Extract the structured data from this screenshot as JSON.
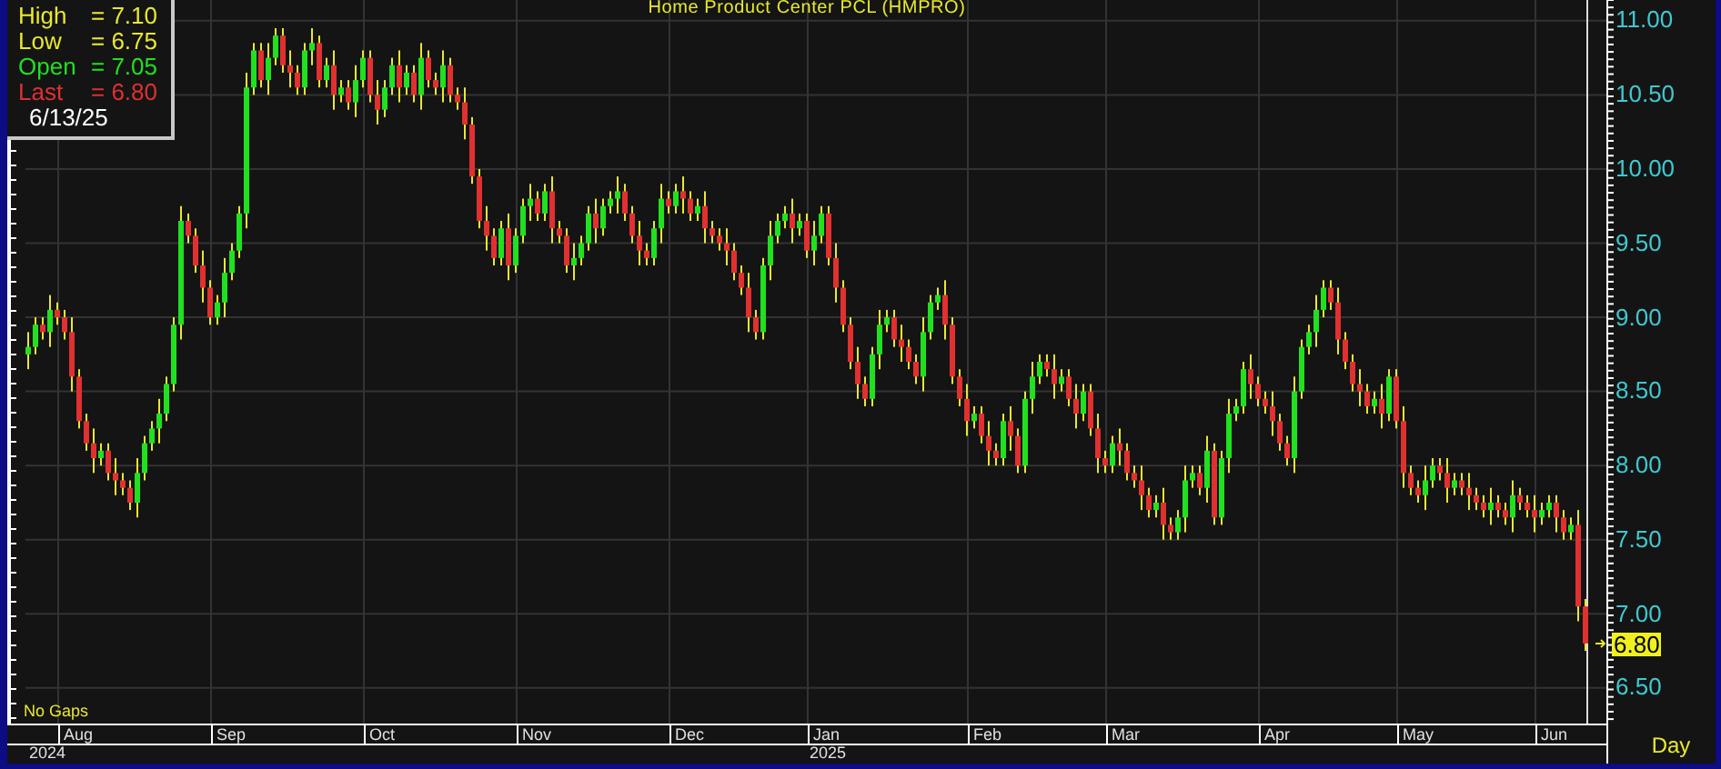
{
  "chart": {
    "legend": [
      {
        "label": "High",
        "value": "= 7.10",
        "color": "#e8e830"
      },
      {
        "label": "Low",
        "value": "= 6.75",
        "color": "#e8e830"
      },
      {
        "label": "Open",
        "value": "= 7.05",
        "color": "#20e020"
      },
      {
        "label": "Last",
        "value": "= 6.80",
        "color": "#e03030"
      }
    ],
    "date": "6/13/25",
    "gap_mode": "No Gaps",
    "period": "Day",
    "last_price": "6.80",
    "years": [
      "2024",
      "2025"
    ],
    "chart_data": {
      "type": "candlestick",
      "title": "Home Product Center PCL (HMPRO)",
      "ylim": [
        6.26,
        11.14
      ],
      "yticks": [
        {
          "value": 11,
          "label": "11.00"
        },
        {
          "value": 10.5,
          "label": "10.50"
        },
        {
          "value": 10,
          "label": "10.00"
        },
        {
          "value": 9.5,
          "label": "9.50"
        },
        {
          "value": 9,
          "label": "9.00"
        },
        {
          "value": 8.5,
          "label": "8.50"
        },
        {
          "value": 8,
          "label": "8.00"
        },
        {
          "value": 7.5,
          "label": "7.50"
        },
        {
          "value": 7,
          "label": "7.00"
        },
        {
          "value": 6.5,
          "label": "6.50"
        }
      ],
      "grid": true,
      "categories": [
        null,
        null,
        null,
        null,
        null,
        null,
        null,
        "Aug",
        null,
        null,
        null,
        null,
        null,
        null,
        null,
        null,
        null,
        null,
        null,
        null,
        null,
        null,
        null,
        null,
        null,
        null,
        null,
        null,
        "Sep",
        null,
        null,
        null,
        null,
        null,
        null,
        null,
        null,
        null,
        null,
        null,
        null,
        null,
        null,
        null,
        null,
        null,
        null,
        null,
        null,
        "Oct",
        null,
        null,
        null,
        null,
        null,
        null,
        null,
        null,
        null,
        null,
        null,
        null,
        null,
        null,
        null,
        null,
        null,
        null,
        null,
        null,
        "Nov",
        null,
        null,
        null,
        null,
        null,
        null,
        null,
        null,
        null,
        null,
        null,
        null,
        null,
        null,
        null,
        null,
        null,
        null,
        null,
        null,
        "Dec",
        null,
        null,
        null,
        null,
        null,
        null,
        null,
        null,
        null,
        null,
        null,
        null,
        null,
        null,
        null,
        null,
        null,
        null,
        "Jan",
        null,
        null,
        null,
        null,
        null,
        null,
        null,
        null,
        null,
        null,
        null,
        null,
        null,
        null,
        null,
        null,
        null,
        null,
        null,
        null,
        null,
        "Feb",
        null,
        null,
        null,
        null,
        null,
        null,
        null,
        null,
        null,
        null,
        null,
        null,
        null,
        null,
        null,
        null,
        null,
        null,
        "Mar",
        null,
        null,
        null,
        null,
        null,
        null,
        null,
        null,
        null,
        null,
        null,
        null,
        null,
        null,
        null,
        null,
        null,
        null,
        null,
        null,
        "Apr",
        null,
        null,
        null,
        null,
        null,
        null,
        null,
        null,
        null,
        null,
        null,
        null,
        null,
        null,
        null,
        null,
        null,
        null,
        "May",
        null,
        null,
        null,
        null,
        null,
        null,
        null,
        null,
        null,
        null,
        null,
        null,
        null,
        null,
        null,
        null,
        null,
        null,
        "Jun",
        null,
        null,
        null,
        null
      ],
      "ohlc": [
        [
          8.75,
          8.9,
          8.65,
          8.8
        ],
        [
          8.8,
          9.0,
          8.75,
          8.95
        ],
        [
          8.95,
          9.0,
          8.85,
          8.9
        ],
        [
          8.9,
          9.15,
          8.8,
          9.05
        ],
        [
          9.05,
          9.1,
          8.95,
          9.0
        ],
        [
          9.0,
          9.05,
          8.85,
          8.9
        ],
        [
          8.9,
          9.0,
          8.5,
          8.6
        ],
        [
          8.6,
          8.65,
          8.25,
          8.3
        ],
        [
          8.3,
          8.35,
          8.1,
          8.15
        ],
        [
          8.15,
          8.25,
          7.95,
          8.05
        ],
        [
          8.05,
          8.15,
          8.0,
          8.1
        ],
        [
          8.1,
          8.15,
          7.9,
          7.95
        ],
        [
          7.95,
          8.05,
          7.8,
          7.9
        ],
        [
          7.9,
          7.95,
          7.8,
          7.85
        ],
        [
          7.85,
          7.9,
          7.7,
          7.75
        ],
        [
          7.75,
          8.05,
          7.65,
          7.95
        ],
        [
          7.95,
          8.2,
          7.9,
          8.15
        ],
        [
          8.15,
          8.3,
          8.1,
          8.25
        ],
        [
          8.25,
          8.45,
          8.15,
          8.35
        ],
        [
          8.35,
          8.6,
          8.3,
          8.55
        ],
        [
          8.55,
          9.0,
          8.5,
          8.95
        ],
        [
          8.95,
          9.75,
          8.85,
          9.65
        ],
        [
          9.65,
          9.7,
          9.5,
          9.55
        ],
        [
          9.55,
          9.6,
          9.3,
          9.35
        ],
        [
          9.35,
          9.45,
          9.1,
          9.2
        ],
        [
          9.2,
          9.25,
          8.95,
          9.0
        ],
        [
          9.0,
          9.15,
          8.95,
          9.1
        ],
        [
          9.1,
          9.4,
          9.0,
          9.3
        ],
        [
          9.3,
          9.5,
          9.25,
          9.45
        ],
        [
          9.45,
          9.75,
          9.4,
          9.7
        ],
        [
          9.7,
          10.65,
          9.6,
          10.55
        ],
        [
          10.55,
          10.85,
          10.5,
          10.8
        ],
        [
          10.8,
          10.85,
          10.55,
          10.6
        ],
        [
          10.6,
          10.85,
          10.5,
          10.75
        ],
        [
          10.75,
          10.95,
          10.7,
          10.9
        ],
        [
          10.9,
          10.95,
          10.65,
          10.7
        ],
        [
          10.7,
          10.8,
          10.55,
          10.65
        ],
        [
          10.65,
          10.7,
          10.5,
          10.55
        ],
        [
          10.55,
          10.85,
          10.5,
          10.8
        ],
        [
          10.8,
          10.95,
          10.7,
          10.85
        ],
        [
          10.85,
          10.9,
          10.55,
          10.6
        ],
        [
          10.6,
          10.75,
          10.55,
          10.7
        ],
        [
          10.7,
          10.8,
          10.4,
          10.5
        ],
        [
          10.5,
          10.6,
          10.45,
          10.55
        ],
        [
          10.55,
          10.6,
          10.4,
          10.45
        ],
        [
          10.45,
          10.7,
          10.35,
          10.6
        ],
        [
          10.6,
          10.8,
          10.55,
          10.75
        ],
        [
          10.75,
          10.8,
          10.45,
          10.5
        ],
        [
          10.5,
          10.6,
          10.3,
          10.4
        ],
        [
          10.4,
          10.6,
          10.35,
          10.55
        ],
        [
          10.55,
          10.75,
          10.5,
          10.7
        ],
        [
          10.7,
          10.8,
          10.45,
          10.55
        ],
        [
          10.55,
          10.7,
          10.5,
          10.65
        ],
        [
          10.65,
          10.7,
          10.45,
          10.5
        ],
        [
          10.5,
          10.85,
          10.4,
          10.75
        ],
        [
          10.75,
          10.8,
          10.55,
          10.6
        ],
        [
          10.6,
          10.65,
          10.5,
          10.55
        ],
        [
          10.55,
          10.8,
          10.45,
          10.7
        ],
        [
          10.7,
          10.75,
          10.45,
          10.5
        ],
        [
          10.5,
          10.55,
          10.4,
          10.45
        ],
        [
          10.45,
          10.55,
          10.2,
          10.3
        ],
        [
          10.3,
          10.35,
          9.9,
          9.95
        ],
        [
          9.95,
          10.0,
          9.6,
          9.65
        ],
        [
          9.65,
          9.75,
          9.45,
          9.55
        ],
        [
          9.55,
          9.6,
          9.35,
          9.4
        ],
        [
          9.4,
          9.65,
          9.35,
          9.6
        ],
        [
          9.6,
          9.7,
          9.25,
          9.35
        ],
        [
          9.35,
          9.6,
          9.3,
          9.55
        ],
        [
          9.55,
          9.8,
          9.5,
          9.75
        ],
        [
          9.75,
          9.9,
          9.65,
          9.8
        ],
        [
          9.8,
          9.85,
          9.65,
          9.7
        ],
        [
          9.7,
          9.9,
          9.65,
          9.85
        ],
        [
          9.85,
          9.95,
          9.5,
          9.6
        ],
        [
          9.6,
          9.65,
          9.5,
          9.55
        ],
        [
          9.55,
          9.6,
          9.3,
          9.35
        ],
        [
          9.35,
          9.5,
          9.25,
          9.4
        ],
        [
          9.4,
          9.55,
          9.35,
          9.5
        ],
        [
          9.5,
          9.75,
          9.45,
          9.7
        ],
        [
          9.7,
          9.8,
          9.5,
          9.6
        ],
        [
          9.6,
          9.8,
          9.55,
          9.75
        ],
        [
          9.75,
          9.85,
          9.7,
          9.8
        ],
        [
          9.8,
          9.95,
          9.7,
          9.85
        ],
        [
          9.85,
          9.9,
          9.65,
          9.7
        ],
        [
          9.7,
          9.75,
          9.5,
          9.55
        ],
        [
          9.55,
          9.65,
          9.35,
          9.45
        ],
        [
          9.45,
          9.5,
          9.35,
          9.4
        ],
        [
          9.4,
          9.65,
          9.35,
          9.6
        ],
        [
          9.6,
          9.9,
          9.5,
          9.8
        ],
        [
          9.8,
          9.85,
          9.7,
          9.75
        ],
        [
          9.75,
          9.9,
          9.7,
          9.85
        ],
        [
          9.85,
          9.95,
          9.7,
          9.8
        ],
        [
          9.8,
          9.85,
          9.65,
          9.7
        ],
        [
          9.7,
          9.8,
          9.65,
          9.75
        ],
        [
          9.75,
          9.85,
          9.5,
          9.6
        ],
        [
          9.6,
          9.65,
          9.5,
          9.55
        ],
        [
          9.55,
          9.6,
          9.45,
          9.5
        ],
        [
          9.5,
          9.6,
          9.35,
          9.45
        ],
        [
          9.45,
          9.5,
          9.25,
          9.3
        ],
        [
          9.3,
          9.35,
          9.15,
          9.2
        ],
        [
          9.2,
          9.3,
          8.9,
          9.0
        ],
        [
          9.0,
          9.05,
          8.85,
          8.9
        ],
        [
          8.9,
          9.4,
          8.85,
          9.35
        ],
        [
          9.35,
          9.65,
          9.25,
          9.55
        ],
        [
          9.55,
          9.7,
          9.5,
          9.65
        ],
        [
          9.65,
          9.75,
          9.6,
          9.7
        ],
        [
          9.7,
          9.8,
          9.5,
          9.6
        ],
        [
          9.6,
          9.7,
          9.55,
          9.65
        ],
        [
          9.65,
          9.7,
          9.4,
          9.45
        ],
        [
          9.45,
          9.65,
          9.35,
          9.55
        ],
        [
          9.55,
          9.75,
          9.5,
          9.7
        ],
        [
          9.7,
          9.75,
          9.35,
          9.4
        ],
        [
          9.4,
          9.5,
          9.1,
          9.2
        ],
        [
          9.2,
          9.25,
          8.9,
          8.95
        ],
        [
          8.95,
          9.0,
          8.65,
          8.7
        ],
        [
          8.7,
          8.8,
          8.45,
          8.55
        ],
        [
          8.55,
          8.6,
          8.4,
          8.45
        ],
        [
          8.45,
          8.8,
          8.4,
          8.75
        ],
        [
          8.75,
          9.05,
          8.65,
          8.95
        ],
        [
          8.95,
          9.05,
          8.9,
          9.0
        ],
        [
          9.0,
          9.05,
          8.8,
          8.85
        ],
        [
          8.85,
          8.95,
          8.7,
          8.8
        ],
        [
          8.8,
          8.85,
          8.65,
          8.7
        ],
        [
          8.7,
          8.75,
          8.55,
          8.6
        ],
        [
          8.6,
          9.0,
          8.5,
          8.9
        ],
        [
          8.9,
          9.15,
          8.85,
          9.1
        ],
        [
          9.1,
          9.2,
          9.05,
          9.15
        ],
        [
          9.15,
          9.25,
          8.85,
          8.95
        ],
        [
          8.95,
          9.0,
          8.55,
          8.6
        ],
        [
          8.6,
          8.65,
          8.4,
          8.45
        ],
        [
          8.45,
          8.55,
          8.2,
          8.3
        ],
        [
          8.3,
          8.4,
          8.25,
          8.35
        ],
        [
          8.35,
          8.4,
          8.15,
          8.2
        ],
        [
          8.2,
          8.3,
          8.0,
          8.1
        ],
        [
          8.1,
          8.15,
          8.0,
          8.05
        ],
        [
          8.05,
          8.35,
          8.0,
          8.3
        ],
        [
          8.3,
          8.4,
          8.1,
          8.2
        ],
        [
          8.2,
          8.25,
          7.95,
          8.0
        ],
        [
          8.0,
          8.5,
          7.95,
          8.45
        ],
        [
          8.45,
          8.7,
          8.35,
          8.6
        ],
        [
          8.6,
          8.75,
          8.55,
          8.7
        ],
        [
          8.7,
          8.75,
          8.6,
          8.65
        ],
        [
          8.65,
          8.75,
          8.45,
          8.55
        ],
        [
          8.55,
          8.65,
          8.5,
          8.6
        ],
        [
          8.6,
          8.65,
          8.4,
          8.45
        ],
        [
          8.45,
          8.55,
          8.25,
          8.35
        ],
        [
          8.35,
          8.55,
          8.3,
          8.5
        ],
        [
          8.5,
          8.55,
          8.2,
          8.25
        ],
        [
          8.25,
          8.35,
          7.95,
          8.05
        ],
        [
          8.05,
          8.1,
          7.95,
          8.0
        ],
        [
          8.0,
          8.2,
          7.95,
          8.15
        ],
        [
          8.15,
          8.25,
          8.0,
          8.1
        ],
        [
          8.1,
          8.15,
          7.9,
          7.95
        ],
        [
          7.95,
          8.0,
          7.85,
          7.9
        ],
        [
          7.9,
          8.0,
          7.7,
          7.8
        ],
        [
          7.8,
          7.85,
          7.65,
          7.7
        ],
        [
          7.7,
          7.8,
          7.65,
          7.75
        ],
        [
          7.75,
          7.85,
          7.5,
          7.6
        ],
        [
          7.6,
          7.65,
          7.5,
          7.55
        ],
        [
          7.55,
          7.7,
          7.5,
          7.65
        ],
        [
          7.65,
          8.0,
          7.55,
          7.9
        ],
        [
          7.9,
          8.0,
          7.85,
          7.95
        ],
        [
          7.95,
          8.0,
          7.8,
          7.85
        ],
        [
          7.85,
          8.2,
          7.75,
          8.1
        ],
        [
          8.1,
          8.15,
          7.6,
          7.65
        ],
        [
          7.65,
          8.1,
          7.6,
          8.05
        ],
        [
          8.05,
          8.45,
          7.95,
          8.35
        ],
        [
          8.35,
          8.45,
          8.3,
          8.4
        ],
        [
          8.4,
          8.7,
          8.35,
          8.65
        ],
        [
          8.65,
          8.75,
          8.45,
          8.55
        ],
        [
          8.55,
          8.6,
          8.4,
          8.45
        ],
        [
          8.45,
          8.5,
          8.35,
          8.4
        ],
        [
          8.4,
          8.5,
          8.2,
          8.3
        ],
        [
          8.3,
          8.35,
          8.1,
          8.15
        ],
        [
          8.15,
          8.2,
          8.0,
          8.05
        ],
        [
          8.05,
          8.6,
          7.95,
          8.5
        ],
        [
          8.5,
          8.85,
          8.45,
          8.8
        ],
        [
          8.8,
          8.95,
          8.75,
          8.9
        ],
        [
          8.9,
          9.15,
          8.8,
          9.05
        ],
        [
          9.05,
          9.25,
          9.0,
          9.2
        ],
        [
          9.2,
          9.25,
          9.05,
          9.1
        ],
        [
          9.1,
          9.2,
          8.75,
          8.85
        ],
        [
          8.85,
          8.9,
          8.65,
          8.7
        ],
        [
          8.7,
          8.75,
          8.5,
          8.55
        ],
        [
          8.55,
          8.65,
          8.4,
          8.5
        ],
        [
          8.5,
          8.55,
          8.35,
          8.4
        ],
        [
          8.4,
          8.5,
          8.35,
          8.45
        ],
        [
          8.45,
          8.55,
          8.25,
          8.35
        ],
        [
          8.35,
          8.65,
          8.3,
          8.6
        ],
        [
          8.6,
          8.65,
          8.25,
          8.3
        ],
        [
          8.3,
          8.4,
          7.85,
          7.95
        ],
        [
          7.95,
          8.0,
          7.8,
          7.85
        ],
        [
          7.85,
          7.9,
          7.75,
          7.8
        ],
        [
          7.8,
          8.0,
          7.7,
          7.9
        ],
        [
          7.9,
          8.05,
          7.85,
          8.0
        ],
        [
          8.0,
          8.05,
          7.9,
          7.95
        ],
        [
          7.95,
          8.05,
          7.75,
          7.85
        ],
        [
          7.85,
          7.95,
          7.8,
          7.9
        ],
        [
          7.9,
          7.95,
          7.8,
          7.85
        ],
        [
          7.85,
          7.95,
          7.7,
          7.8
        ],
        [
          7.8,
          7.85,
          7.7,
          7.75
        ],
        [
          7.75,
          7.8,
          7.65,
          7.7
        ],
        [
          7.7,
          7.85,
          7.6,
          7.75
        ],
        [
          7.75,
          7.8,
          7.65,
          7.7
        ],
        [
          7.7,
          7.75,
          7.6,
          7.65
        ],
        [
          7.65,
          7.9,
          7.55,
          7.8
        ],
        [
          7.8,
          7.85,
          7.7,
          7.75
        ],
        [
          7.75,
          7.8,
          7.65,
          7.7
        ],
        [
          7.7,
          7.8,
          7.55,
          7.65
        ],
        [
          7.65,
          7.75,
          7.6,
          7.7
        ],
        [
          7.7,
          7.8,
          7.65,
          7.75
        ],
        [
          7.75,
          7.8,
          7.55,
          7.65
        ],
        [
          7.65,
          7.7,
          7.5,
          7.55
        ],
        [
          7.55,
          7.65,
          7.5,
          7.6
        ],
        [
          7.6,
          7.7,
          6.95,
          7.05
        ],
        [
          7.05,
          7.1,
          6.75,
          6.8
        ]
      ]
    }
  }
}
